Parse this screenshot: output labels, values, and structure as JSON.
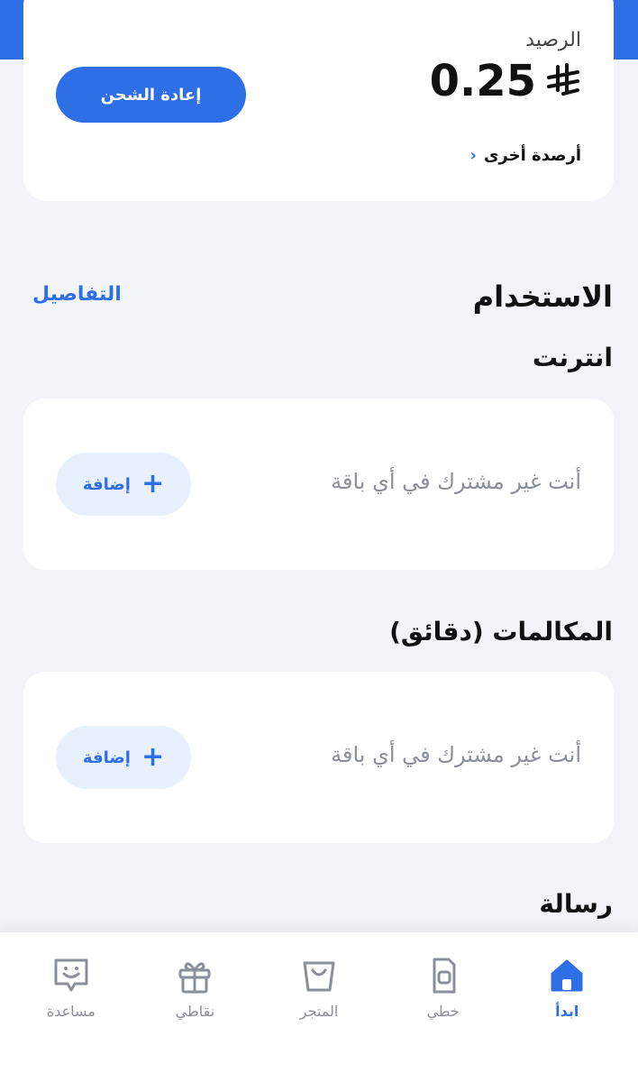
{
  "balance": {
    "label": "الرصيد",
    "amount": "0.25",
    "other_balances_label": "أرصدة أخرى",
    "recharge_label": "إعادة الشحن"
  },
  "usage": {
    "title": "الاستخدام",
    "details_label": "التفاصيل",
    "sections": [
      {
        "title": "انترنت",
        "message": "أنت غير مشترك في أي باقة",
        "add_label": "إضافة"
      },
      {
        "title": "المكالمات (دقائق)",
        "message": "أنت غير مشترك في أي باقة",
        "add_label": "إضافة"
      },
      {
        "title": "رسالة"
      }
    ]
  },
  "nav": {
    "items": [
      {
        "label": "ابدأ",
        "icon": "home-icon",
        "active": true
      },
      {
        "label": "خطي",
        "icon": "sim-card-icon"
      },
      {
        "label": "المتجر",
        "icon": "shopping-bag-icon"
      },
      {
        "label": "نقاطي",
        "icon": "gift-icon"
      },
      {
        "label": "مساعدة",
        "icon": "chat-smile-icon"
      }
    ]
  },
  "colors": {
    "accent": "#2f6fe6",
    "add_button_bg": "#e7f0fc",
    "muted_text": "#8a8f99",
    "page_bg": "#f3f4f8"
  }
}
